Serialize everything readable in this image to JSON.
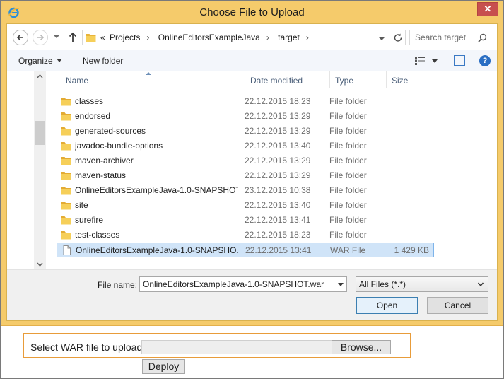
{
  "dialog": {
    "title": "Choose File to Upload",
    "close_label": "✕"
  },
  "nav": {
    "address": {
      "overflow": "«",
      "crumbs": [
        "Projects",
        "OnlineEditorsExampleJava",
        "target"
      ]
    },
    "search_placeholder": "Search target"
  },
  "toolbar": {
    "organize_label": "Organize",
    "new_folder_label": "New folder",
    "help_label": "?"
  },
  "columns": {
    "name": "Name",
    "date": "Date modified",
    "type": "Type",
    "size": "Size"
  },
  "files": [
    {
      "name": "classes",
      "date": "22.12.2015 18:23",
      "type": "File folder",
      "size": "",
      "icon": "folder-icon"
    },
    {
      "name": "endorsed",
      "date": "22.12.2015 13:29",
      "type": "File folder",
      "size": "",
      "icon": "folder-icon"
    },
    {
      "name": "generated-sources",
      "date": "22.12.2015 13:29",
      "type": "File folder",
      "size": "",
      "icon": "folder-icon"
    },
    {
      "name": "javadoc-bundle-options",
      "date": "22.12.2015 13:40",
      "type": "File folder",
      "size": "",
      "icon": "folder-icon"
    },
    {
      "name": "maven-archiver",
      "date": "22.12.2015 13:29",
      "type": "File folder",
      "size": "",
      "icon": "folder-icon"
    },
    {
      "name": "maven-status",
      "date": "22.12.2015 13:29",
      "type": "File folder",
      "size": "",
      "icon": "folder-icon"
    },
    {
      "name": "OnlineEditorsExampleJava-1.0-SNAPSHOT",
      "date": "23.12.2015 10:38",
      "type": "File folder",
      "size": "",
      "icon": "folder-icon"
    },
    {
      "name": "site",
      "date": "22.12.2015 13:40",
      "type": "File folder",
      "size": "",
      "icon": "folder-icon"
    },
    {
      "name": "surefire",
      "date": "22.12.2015 13:41",
      "type": "File folder",
      "size": "",
      "icon": "folder-icon"
    },
    {
      "name": "test-classes",
      "date": "22.12.2015 18:23",
      "type": "File folder",
      "size": "",
      "icon": "folder-icon"
    },
    {
      "name": "OnlineEditorsExampleJava-1.0-SNAPSHO...",
      "date": "22.12.2015 13:41",
      "type": "WAR File",
      "size": "1 429 KB",
      "icon": "file-icon",
      "selected": true
    }
  ],
  "bottom": {
    "file_name_label": "File name:",
    "file_name_value": "OnlineEditorsExampleJava-1.0-SNAPSHOT.war",
    "filter_value": "All Files (*.*)",
    "open_label": "Open",
    "cancel_label": "Cancel"
  },
  "page": {
    "upload_label": "Select WAR file to upload",
    "browse_label": "Browse...",
    "deploy_label": "Deploy"
  },
  "colors": {
    "title_bar": "#f5cb6b",
    "selection": "#d0e4f8",
    "highlight_border": "#e89c3a"
  }
}
